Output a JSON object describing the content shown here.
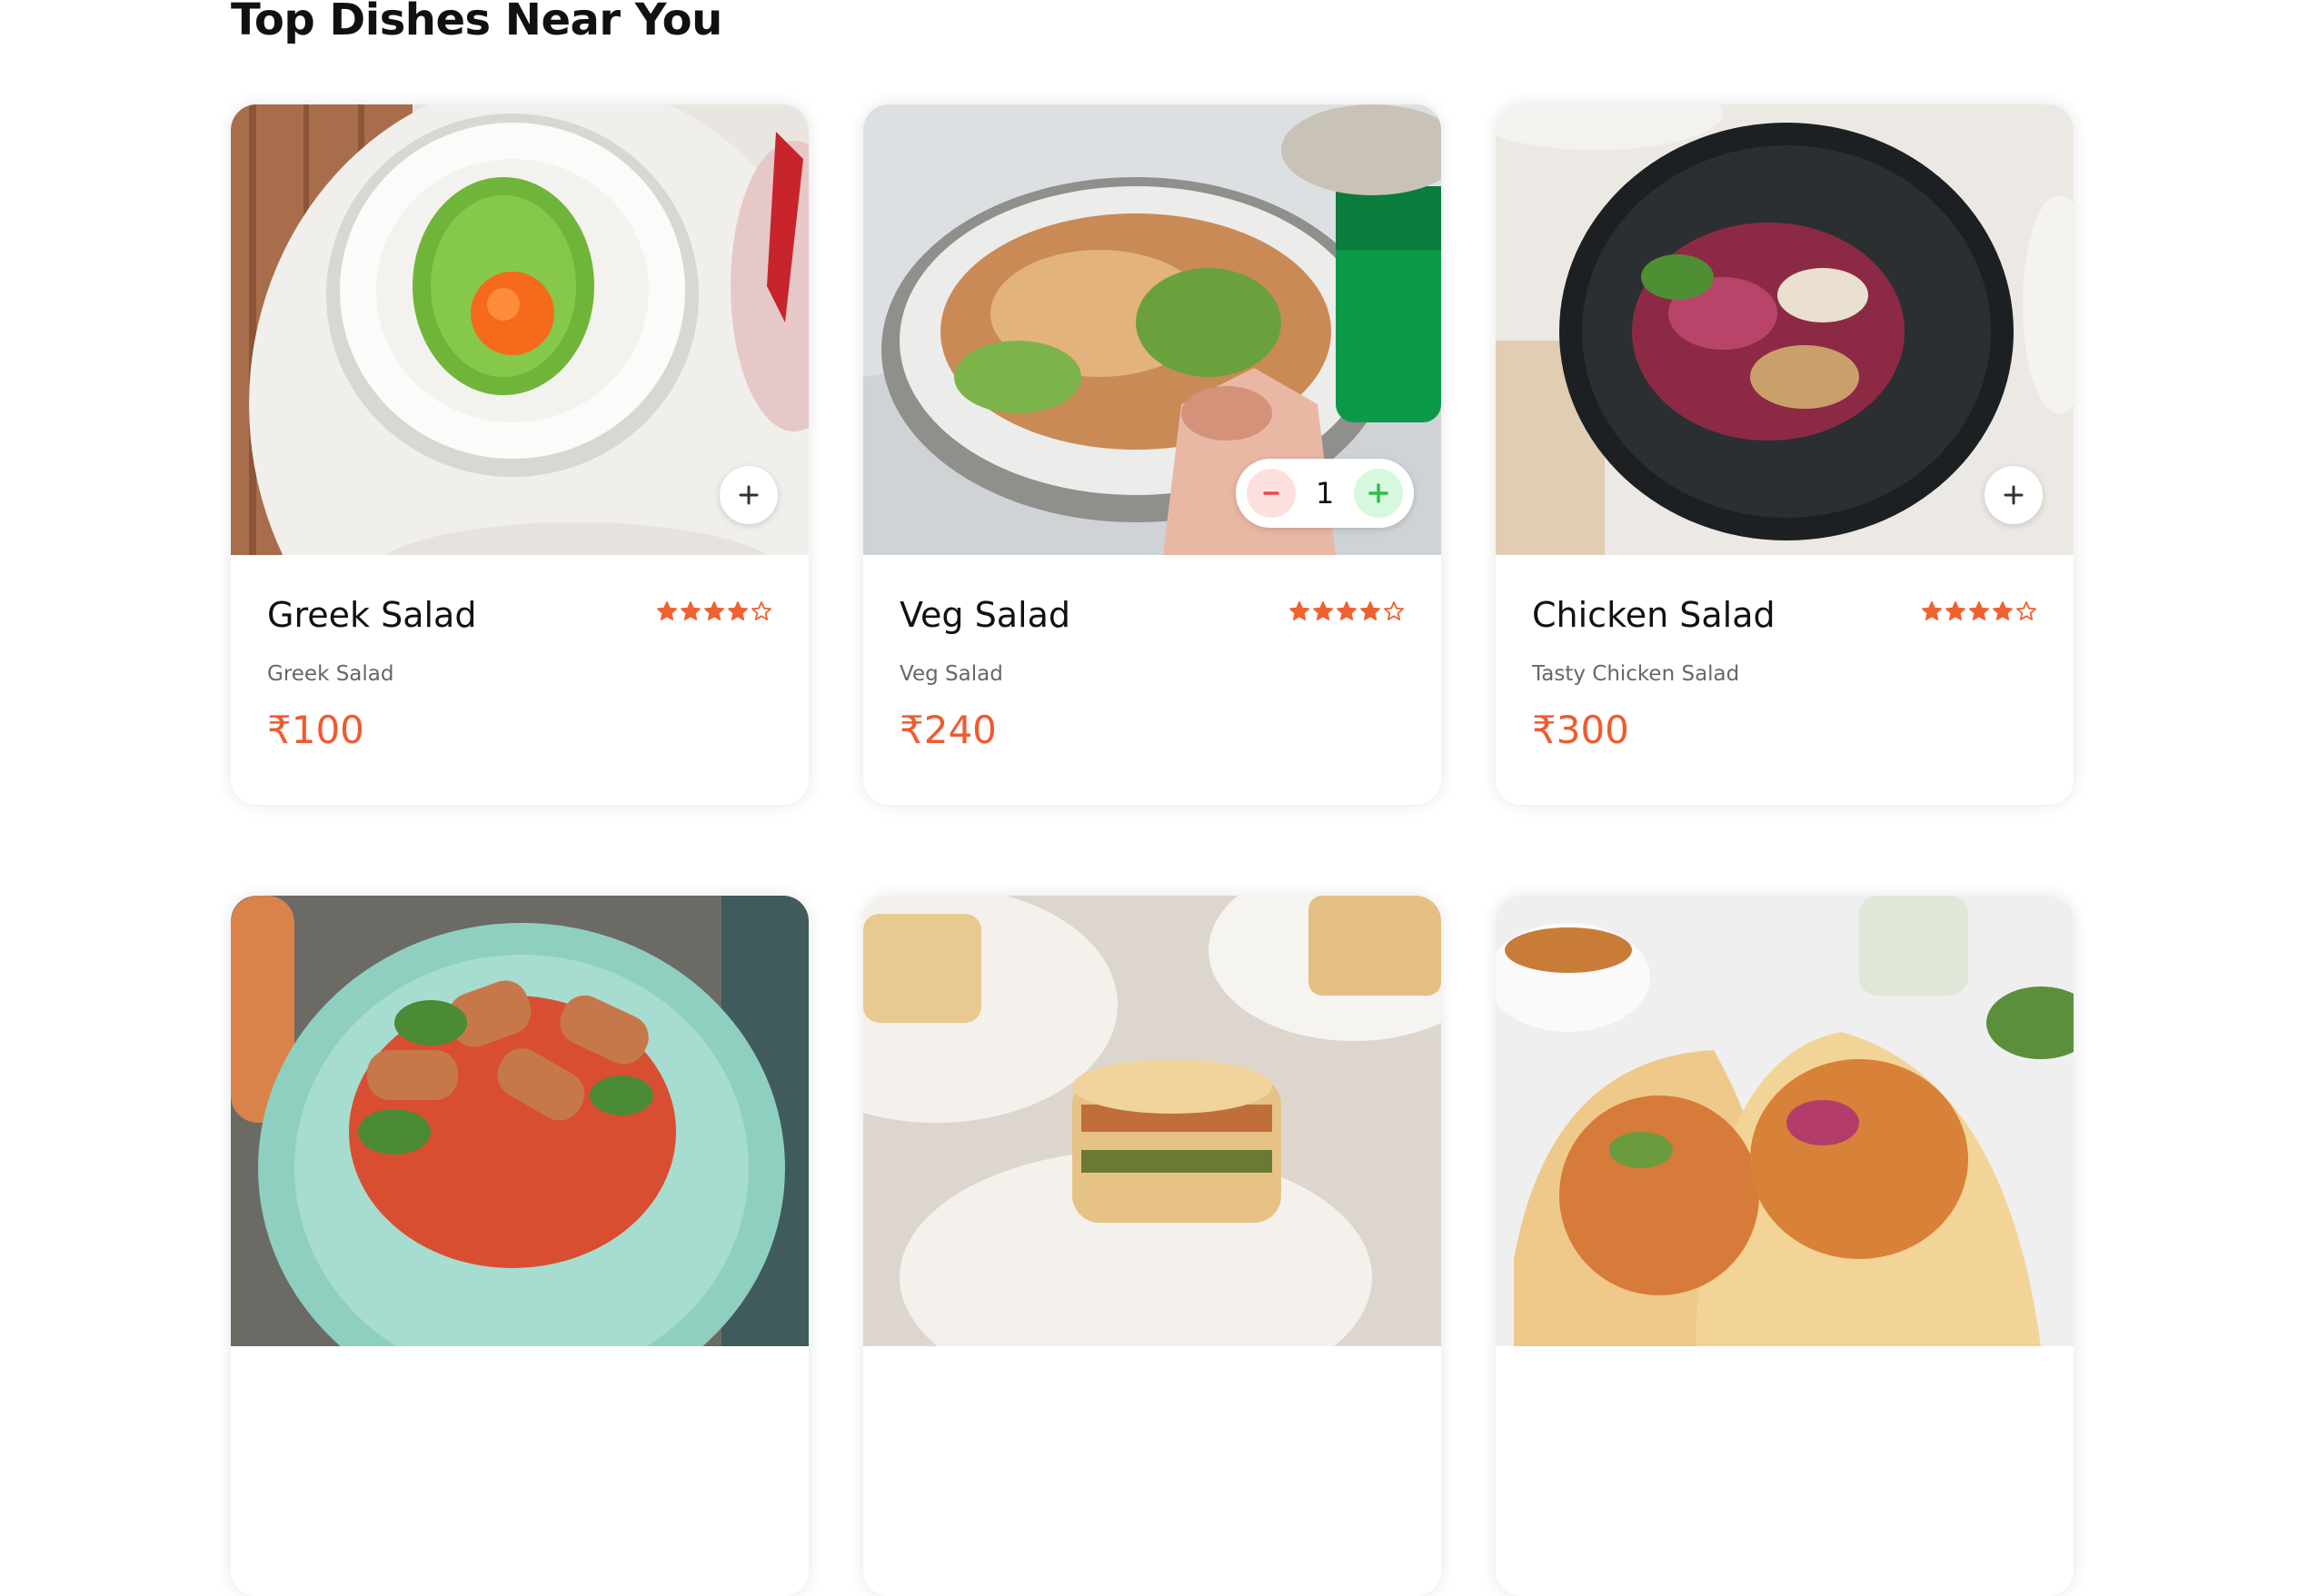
{
  "section": {
    "title": "Top Dishes Near You"
  },
  "colors": {
    "accent": "#f05a2f",
    "star": "#f0612f",
    "minus": "#e84a4a",
    "plus": "#2fbf46"
  },
  "dishes": [
    {
      "name": "Greek Salad",
      "description": "Greek Salad",
      "price": "₹100",
      "rating": 4,
      "max_rating": 5,
      "in_cart": 0,
      "image": "greek-salad-photo"
    },
    {
      "name": "Veg Salad",
      "description": "Veg Salad",
      "price": "₹240",
      "rating": 4,
      "max_rating": 5,
      "in_cart": 1,
      "quantity": "1",
      "image": "veg-salad-photo"
    },
    {
      "name": "Chicken Salad",
      "description": "Tasty Chicken Salad",
      "price": "₹300",
      "rating": 4,
      "max_rating": 5,
      "in_cart": 0,
      "image": "chicken-salad-photo"
    },
    {
      "image": "halloumi-salad-photo"
    },
    {
      "image": "lasagna-photo"
    },
    {
      "image": "chicken-wrap-photo"
    }
  ]
}
